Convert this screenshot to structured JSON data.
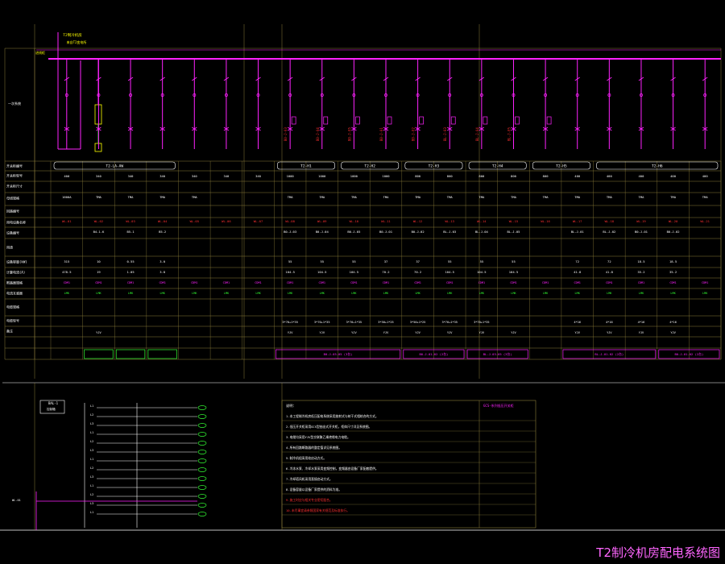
{
  "drawing_title": "T2制冷机房配电系统图",
  "colors": {
    "background": "#000000",
    "magenta": "#ff22ff",
    "yellow": "#ffff00",
    "green": "#33ff33",
    "cyan": "#00e5ff",
    "white": "#ffffff",
    "red": "#ff3030",
    "grid": "#8b7d3a",
    "pink_line": "#ff66cc"
  },
  "incoming": {
    "feeder_label": "T2制冷机房",
    "feeder_sub": "来自T2变电所",
    "main_tag": "进线柜",
    "section_label": "一次系统"
  },
  "row_labels": [
    "开关柜编号",
    "开关柜型号",
    "开关柜尺寸",
    "母线规格",
    "回路编号",
    "用电设备名称",
    "设备编号",
    "用途",
    "设备容量(kW)",
    "计算电流(A)",
    "断路器规格",
    "电流互感器",
    "电缆规格",
    "电缆型号",
    "备注"
  ],
  "cabinets": [
    {
      "tag": "T2-LA-AW",
      "width": "600"
    },
    {
      "tag": "T2-H1",
      "width": "1000"
    },
    {
      "tag": "T2-H2",
      "width": "1000"
    },
    {
      "tag": "T2-H3",
      "width": "1000"
    },
    {
      "tag": "T2-H4",
      "width": "800"
    },
    {
      "tag": "T2-H5",
      "width": "800"
    },
    {
      "tag": "T2-H6",
      "width": "800"
    }
  ],
  "row_values": {
    "widths": [
      "400",
      "340",
      "340",
      "340",
      "340",
      "340",
      "340",
      "1000",
      "1000",
      "1000",
      "1000",
      "800",
      "800",
      "800",
      "800",
      "800",
      "400",
      "400",
      "400",
      "400",
      "400"
    ],
    "bus": [
      "1600A",
      "TMA",
      "TMA",
      "TMA",
      "TMA",
      "",
      "",
      "TMA",
      "TMA",
      "TMA",
      "TMA",
      "TMA",
      "TMA",
      "TMA",
      "TMA",
      "TMA",
      "TMA",
      "TMA",
      "TMA",
      "TMA",
      "TMA"
    ],
    "circuit": [
      "WL-01",
      "WL-02",
      "WL-03",
      "WL-04",
      "WL-05",
      "WL-06",
      "WL-07",
      "WL-08",
      "WL-09",
      "WL-10",
      "WL-11",
      "WL-12",
      "WL-13",
      "WL-14",
      "WL-15",
      "WL-16",
      "WL-17",
      "WL-18",
      "WL-19",
      "WL-20",
      "WL-21"
    ],
    "device": [
      "",
      "B4-1-K",
      "B5-1",
      "B5-2",
      "",
      "",
      "",
      "B0-J-03",
      "B0-J-04",
      "B0-J-05",
      "B0-J-01",
      "B0-J-02",
      "BL-J-03",
      "BL-J-04",
      "BL-J-05",
      "",
      "BL-J-01",
      "BL-J-02",
      "B0-J-01",
      "B0-J-02",
      ""
    ],
    "kw": [
      "315",
      "10",
      "0.55",
      "3.0",
      "",
      "",
      "",
      "55",
      "55",
      "55",
      "37",
      "37",
      "55",
      "55",
      "55",
      "",
      "72",
      "72",
      "18.5",
      "18.5",
      ""
    ],
    "amp": [
      "478.5",
      "19",
      "1.05",
      "3.8",
      "",
      "",
      "",
      "104.5",
      "104.5",
      "104.5",
      "70.2",
      "70.2",
      "104.5",
      "104.5",
      "104.5",
      "",
      "41.8",
      "41.8",
      "35.2",
      "35.2",
      ""
    ],
    "cable": [
      "",
      "",
      "",
      "",
      "",
      "",
      "",
      "3*70+1*35",
      "3*70+1*35",
      "3*70+1*35",
      "3*50+1*25",
      "3*50+1*25",
      "3*70+1*35",
      "3*70+1*35",
      "",
      "",
      "4*16",
      "4*16",
      "4*16",
      "4*16",
      ""
    ],
    "type": [
      "",
      "YJV",
      "",
      "",
      "",
      "",
      "",
      "YJV",
      "YJV",
      "YJV",
      "YJV",
      "YJV",
      "YJV",
      "YJV",
      "YJV",
      "",
      "YJV",
      "YJV",
      "YJV",
      "YJV",
      ""
    ]
  },
  "remark_tags": [
    "B0-J-03-05 (3台)",
    "B0-J-01-02 (2台)",
    "BL-J-03-05 (3台)",
    "BL-J-01-02 (2台)",
    "B0-J-01-02 (2台)"
  ],
  "control_box": {
    "title": "BAL-1",
    "sub": "控制箱",
    "outputs": [
      "L1",
      "L2",
      "L3",
      "L1",
      "L2",
      "L3",
      "L1",
      "L2",
      "L3",
      "L1",
      "L2",
      "L3",
      "L1"
    ]
  },
  "notes": {
    "header": "说明：",
    "ref": "GCS-系列低压开关柜",
    "lines": [
      "1.本工程制冷机房低压配电系统采用放射式与树干式相结合的方式。",
      "2.低压开关柜采用GCS型抽出式开关柜，柜体尺寸详见系统图。",
      "3.电缆均采用YJV型交联聚乙烯绝缘电力电缆。",
      "4.所有回路断路器的整定值详见系统图。",
      "5.制冷机组采用软启动方式。",
      "6.冷冻水泵、冷却水泵采用变频控制，变频器由设备厂家配套提供。",
      "7.冷却塔风机采用直接启动方式。",
      "8.设备容量以设备厂家提供的资料为准。",
      "9.施工时应与相关专业密切配合。",
      "10.未尽事宜请参照国家有关规范及标准执行。"
    ]
  }
}
